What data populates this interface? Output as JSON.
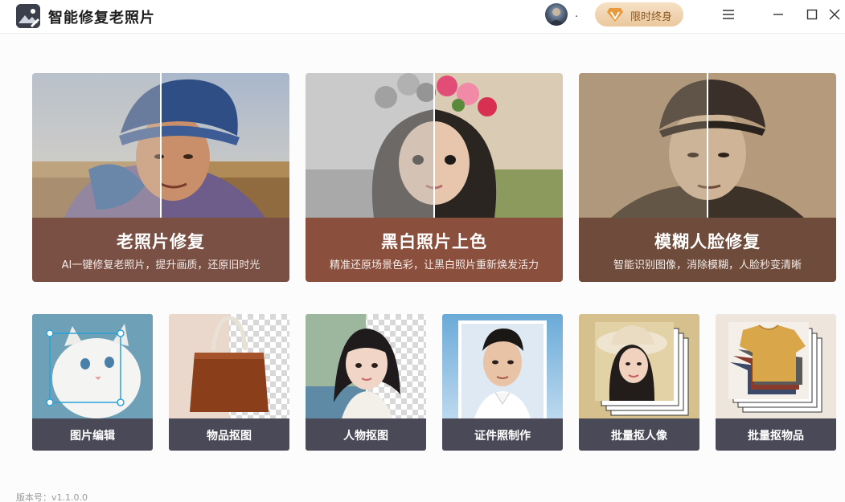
{
  "app": {
    "title": "智能修复老照片",
    "username": ".",
    "vip_label": "限时终身",
    "version": "版本号：v1.1.0.0"
  },
  "colors": {
    "feature_band_1": "#7a4f44",
    "feature_band_2": "#8b4f3d",
    "feature_band_3": "#6e4b3a",
    "tool_band": "#4a4957",
    "vip_gradient_top": "#f6e1c6",
    "vip_gradient_bottom": "#ebc89d"
  },
  "features": [
    {
      "title": "老照片修复",
      "desc": "AI一键修复老照片，提升画质，还原旧时光",
      "icon": "old-photo-restore"
    },
    {
      "title": "黑白照片上色",
      "desc": "精准还原场景色彩，让黑白照片重新焕发活力",
      "icon": "colorize"
    },
    {
      "title": "模糊人脸修复",
      "desc": "智能识别图像，消除模糊，人脸秒变清晰",
      "icon": "face-enhance"
    }
  ],
  "tools": [
    {
      "label": "图片编辑"
    },
    {
      "label": "物品抠图"
    },
    {
      "label": "人物抠图"
    },
    {
      "label": "证件照制作"
    },
    {
      "label": "批量抠人像"
    },
    {
      "label": "批量抠物品"
    }
  ]
}
